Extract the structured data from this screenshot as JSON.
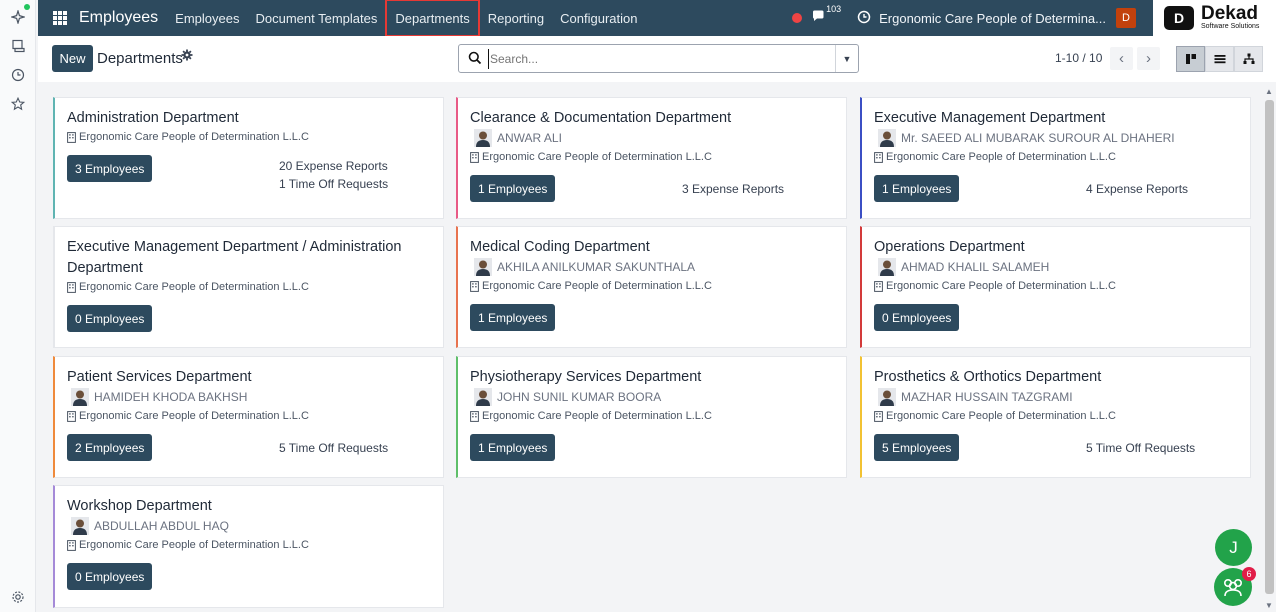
{
  "navbar": {
    "app_name": "Employees",
    "menu": [
      "Employees",
      "Document Templates",
      "Departments",
      "Reporting",
      "Configuration"
    ],
    "active_menu": "Departments",
    "chat_count": "103",
    "company": "Ergonomic Care People of Determina...",
    "user_initial": "D"
  },
  "logo": {
    "name": "Dekad",
    "tagline": "Software Solutions",
    "mark": "D"
  },
  "control_panel": {
    "new_label": "New",
    "breadcrumb": "Departments",
    "search_placeholder": "Search...",
    "pager": "1-10 / 10"
  },
  "departments": [
    {
      "name": "Administration Department",
      "manager": "",
      "company": "Ergonomic Care People of Determination L.L.C",
      "employees": "3 Employees",
      "stats": [
        "20 Expense Reports",
        "1 Time Off Requests"
      ],
      "color": "#5fb4b2"
    },
    {
      "name": "Clearance & Documentation Department",
      "manager": "ANWAR ALI",
      "company": "Ergonomic Care People of Determination L.L.C",
      "employees": "1 Employees",
      "stats": [
        "3 Expense Reports"
      ],
      "color": "#e85a86"
    },
    {
      "name": "Executive Management Department",
      "manager": "Mr. SAEED ALI MUBARAK SUROUR AL DHAHERI",
      "company": "Ergonomic Care People of Determination L.L.C",
      "employees": "1 Employees",
      "stats": [
        "4 Expense Reports"
      ],
      "color": "#3b4fc4"
    },
    {
      "name": "Executive Management Department / Administration Department",
      "manager": "",
      "company": "Ergonomic Care People of Determination L.L.C",
      "employees": "0 Employees",
      "stats": [],
      "color": "#e5e7eb"
    },
    {
      "name": "Medical Coding Department",
      "manager": "AKHILA ANILKUMAR SAKUNTHALA",
      "company": "Ergonomic Care People of Determination L.L.C",
      "employees": "1 Employees",
      "stats": [],
      "color": "#e8734f"
    },
    {
      "name": "Operations Department",
      "manager": "AHMAD KHALIL SALAMEH",
      "company": "Ergonomic Care People of Determination L.L.C",
      "employees": "0 Employees",
      "stats": [],
      "color": "#d33a3a"
    },
    {
      "name": "Patient Services Department",
      "manager": "HAMIDEH KHODA BAKHSH",
      "company": "Ergonomic Care People of Determination L.L.C",
      "employees": "2 Employees",
      "stats": [
        "5 Time Off Requests"
      ],
      "color": "#ef8a3c"
    },
    {
      "name": "Physiotherapy Services Department",
      "manager": "JOHN SUNIL KUMAR BOORA",
      "company": "Ergonomic Care People of Determination L.L.C",
      "employees": "1 Employees",
      "stats": [],
      "color": "#5fbf6a"
    },
    {
      "name": "Prosthetics & Orthotics Department",
      "manager": "MAZHAR HUSSAIN TAZGRAMI",
      "company": "Ergonomic Care People of Determination L.L.C",
      "employees": "5 Employees",
      "stats": [
        "5 Time Off Requests"
      ],
      "color": "#f2c232"
    },
    {
      "name": "Workshop Department",
      "manager": "ABDULLAH ABDUL HAQ",
      "company": "Ergonomic Care People of Determination L.L.C",
      "employees": "0 Employees",
      "stats": [],
      "color": "#a58ad8"
    }
  ],
  "fab": {
    "letter": "J",
    "badge": "6"
  },
  "colors": {
    "navbar": "#2d4a5e",
    "primary_button": "#2d4a5e",
    "active_highlight": "#e53935"
  }
}
